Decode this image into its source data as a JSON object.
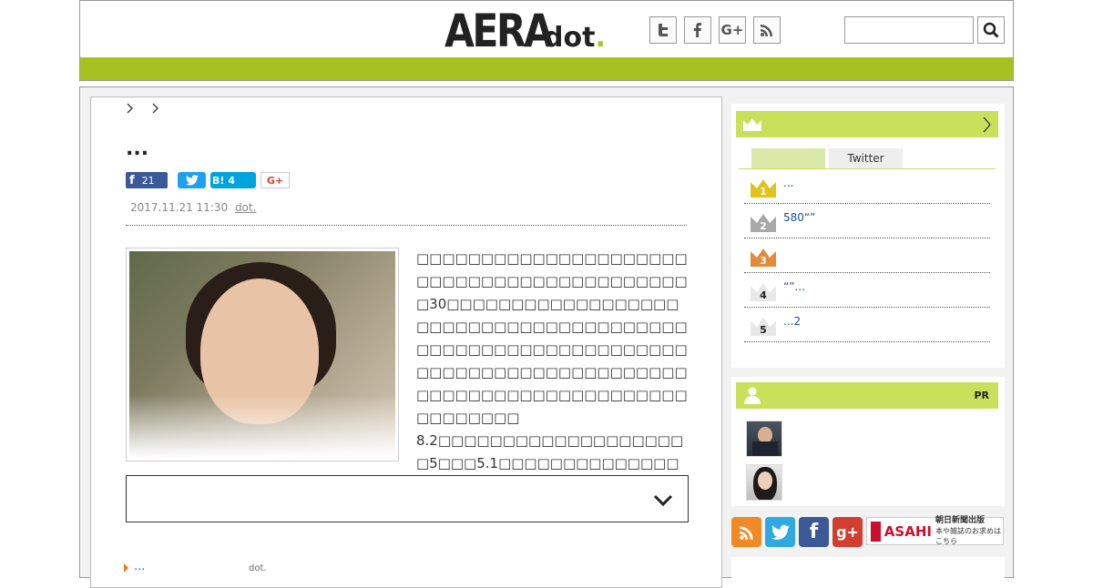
{
  "header": {
    "logo_main": "AERA",
    "logo_sub": "dot",
    "logo_period": ".",
    "social_icons": [
      "twitter-icon",
      "facebook-icon",
      "google-plus-icon",
      "rss-icon"
    ],
    "search_placeholder": ""
  },
  "article": {
    "title": "...",
    "share": {
      "facebook_count": "21",
      "hatena_label": "B!",
      "hatena_count": "4",
      "google_label": "G+"
    },
    "date": "2017.11.21 11:30",
    "source": "dot.",
    "body_lines": [
      "□□□□□□□□□□□□□□□□□□□□□□□□□□□□□□□□□□□□□□□□□□□30□□□□□□□□□□□□□□□□□□□□□□□□□□□□□□□□□□□□□□□□□□□□□□□□□□□□□□□□□□□□□□□□□□□□□□□□□□□□□□□□□□□□□□□□□□□□□□□□□□□□□□□□□□□□□□",
      "8.2□□□□□□□□□□□□□□□□□□□□5□□□5.1□□□□□□□□□□□□□□□□□□□□□□"
    ],
    "related_link": "...",
    "related_source": "dot."
  },
  "sidebar": {
    "tabs": [
      "",
      "Twitter"
    ],
    "ranking": [
      {
        "rank": "1",
        "text": "...",
        "color": "#e4c21c"
      },
      {
        "rank": "2",
        "text": "580“”",
        "color": "#a8a8a8"
      },
      {
        "rank": "3",
        "text": "",
        "color": "#e2893a"
      },
      {
        "rank": "4",
        "text": "“”...",
        "color": "#e8e8e8"
      },
      {
        "rank": "5",
        "text": "...2",
        "color": "#e8e8e8"
      }
    ],
    "pr_label": "PR",
    "footer_icons": [
      "rss-icon",
      "twitter-icon",
      "facebook-icon",
      "google-plus-icon"
    ],
    "asahi": {
      "brand": "ASAHI",
      "line1": "朝日新聞出版",
      "line2": "本や雑誌のお求めはこちら"
    }
  }
}
